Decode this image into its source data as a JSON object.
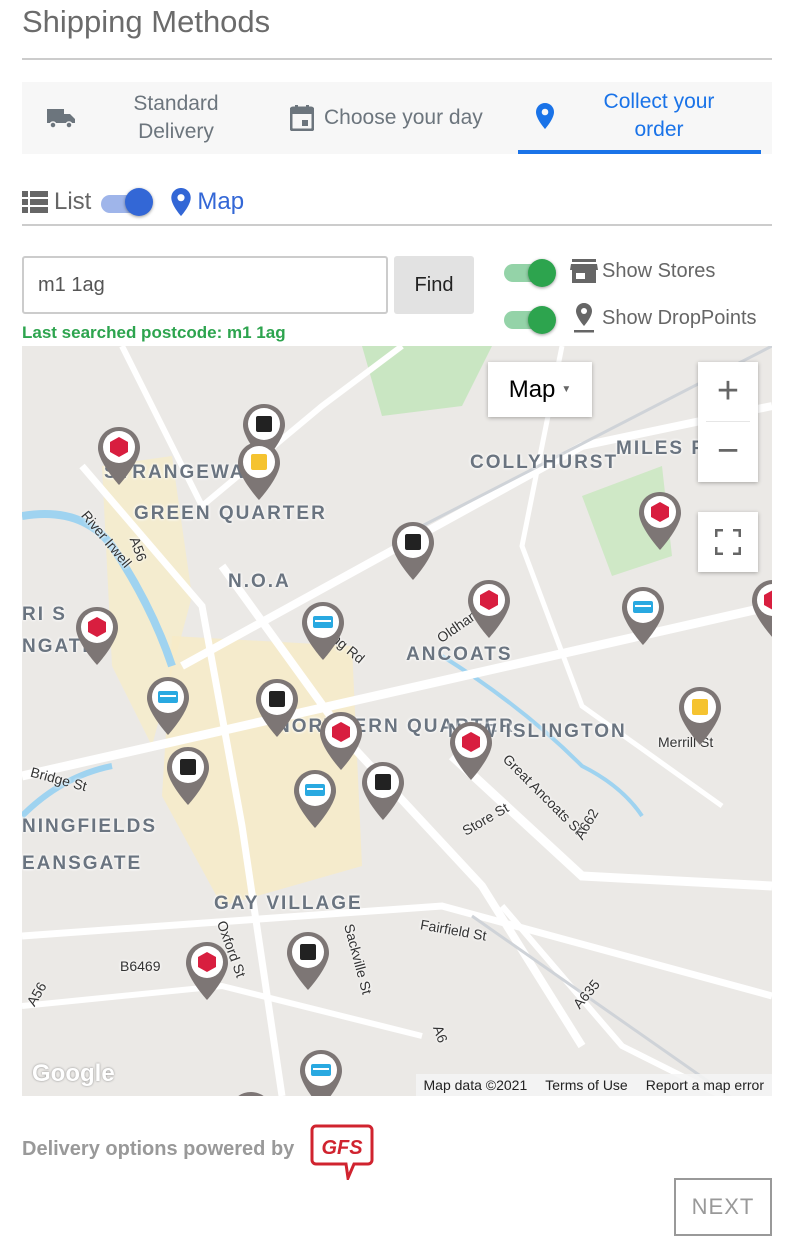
{
  "page_title": "Shipping Methods",
  "tabs": [
    {
      "label": "Standard Delivery",
      "icon": "truck-icon"
    },
    {
      "label": "Choose your day",
      "icon": "calendar-icon"
    },
    {
      "label": "Collect your order",
      "icon": "map-pin-icon",
      "active": true
    }
  ],
  "view_toggle": {
    "list_label": "List",
    "map_label": "Map",
    "selected": "Map"
  },
  "search": {
    "value": "m1 1ag",
    "find_label": "Find",
    "last_searched": "Last searched postcode: m1 1ag"
  },
  "filters": [
    {
      "label": "Show Stores",
      "on": true,
      "icon": "store-icon"
    },
    {
      "label": "Show DropPoints",
      "on": true,
      "icon": "map-pin-icon"
    }
  ],
  "map": {
    "type_button": "Map",
    "zoom_in": "+",
    "zoom_out": "−",
    "labels": [
      "STRANGEWAYS",
      "GREEN QUARTER",
      "COLLYHURST",
      "MILES P",
      "N.O.A",
      "RI S",
      "NGATE",
      "ANCOATS",
      "NORTHERN QUARTER",
      "NEW ISLINGTON",
      "NINGFIELDS",
      "EANSGATE",
      "GAY VILLAGE"
    ],
    "streets": [
      "River Irwell",
      "A56",
      "Ring Rd",
      "Oldham Rd",
      "Great Ancoats St",
      "Store St",
      "A662",
      "Merrill St",
      "Bridge St",
      "Fairfield St",
      "Oxford St",
      "Sackville St",
      "B6469",
      "A635",
      "A6",
      "A56"
    ],
    "pins": [
      "red",
      "black",
      "yellow",
      "red",
      "black",
      "blue",
      "red",
      "red",
      "black",
      "blue",
      "red",
      "blue",
      "red",
      "black",
      "red",
      "black",
      "blue",
      "yellow",
      "red",
      "black",
      "blue",
      "black"
    ],
    "pin_colors": {
      "red": "#d81e3f",
      "black": "#222222",
      "yellow": "#f5c330",
      "blue": "#29a9e1"
    },
    "google_logo": "Google",
    "attribution": [
      "Map data ©2021",
      "Terms of Use",
      "Report a map error"
    ]
  },
  "footer": {
    "powered_by": "Delivery options powered by",
    "logo": "GFS",
    "next_label": "NEXT"
  },
  "colors": {
    "accent": "#1a73e8",
    "toggle_green": "#2da44e",
    "toggle_blue": "#3367d6"
  }
}
